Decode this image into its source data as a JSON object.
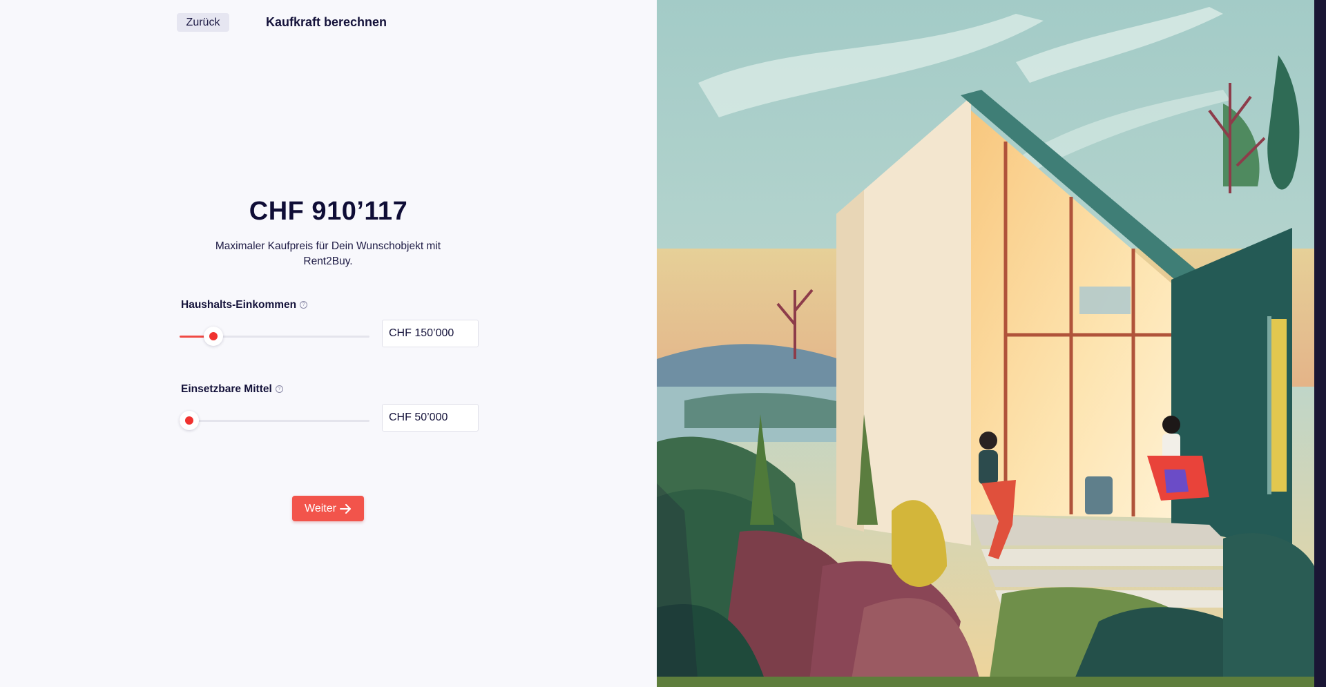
{
  "header": {
    "back_label": "Zurück",
    "title": "Kaufkraft berechnen"
  },
  "result": {
    "amount": "CHF 910’117",
    "description": "Maximaler Kaufpreis für Dein Wunschobjekt mit Rent2Buy."
  },
  "fields": [
    {
      "label": "Haushalts-Einkommen",
      "help_icon": "question-circle-icon",
      "value": "CHF 150’000",
      "slider_fraction": 0.14
    },
    {
      "label": "Einsetzbare Mittel",
      "help_icon": "question-circle-icon",
      "value": "CHF 50’000",
      "slider_fraction": 0.0
    }
  ],
  "actions": {
    "next_label": "Weiter",
    "next_icon": "arrow-right-icon"
  },
  "illustration": {
    "subject": "house-illustration"
  },
  "colors": {
    "accent": "#f0322f",
    "button": "#f2544b",
    "background": "#f8f8fc",
    "text": "#14123a"
  }
}
